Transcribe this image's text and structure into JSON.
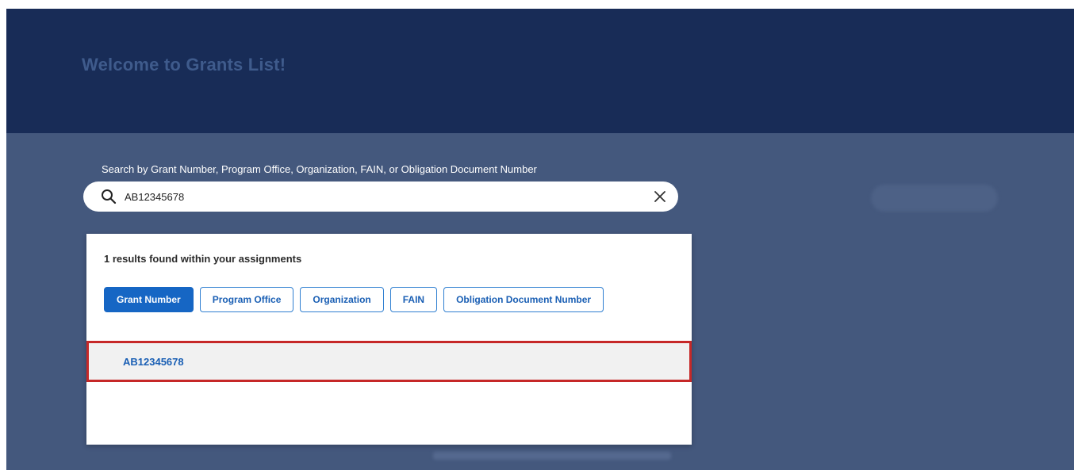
{
  "header": {
    "title": "Welcome to Grants List!"
  },
  "search": {
    "label": "Search by Grant Number, Program Office, Organization, FAIN, or Obligation Document Number",
    "value": "AB12345678",
    "search_icon": "search-icon",
    "clear_icon": "close-icon"
  },
  "results": {
    "count_text": "1 results found within your assignments",
    "tabs": [
      {
        "label": "Grant Number",
        "active": true
      },
      {
        "label": "Program Office",
        "active": false
      },
      {
        "label": "Organization",
        "active": false
      },
      {
        "label": "FAIN",
        "active": false
      },
      {
        "label": "Obligation Document Number",
        "active": false
      }
    ],
    "items": [
      {
        "label": "AB12345678",
        "highlighted": true
      }
    ]
  },
  "colors": {
    "header_bg": "#182c57",
    "accent": "#1666c4",
    "highlight_border": "#c62828"
  }
}
